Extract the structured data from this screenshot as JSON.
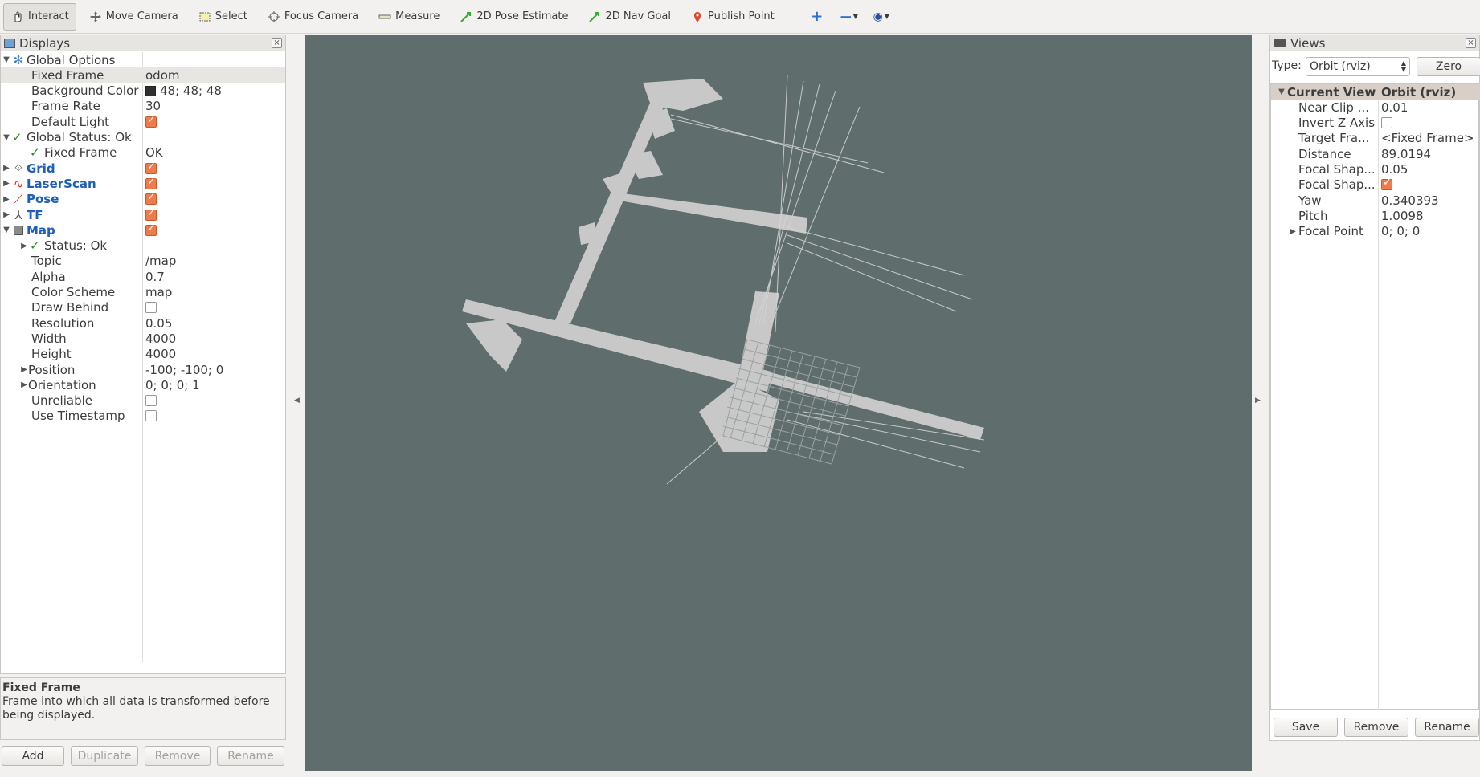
{
  "toolbar": {
    "tools": [
      {
        "label": "Interact",
        "icon": "hand-icon",
        "active": true
      },
      {
        "label": "Move Camera",
        "icon": "move-camera-icon"
      },
      {
        "label": "Select",
        "icon": "select-icon"
      },
      {
        "label": "Focus Camera",
        "icon": "focus-camera-icon"
      },
      {
        "label": "Measure",
        "icon": "ruler-icon"
      },
      {
        "label": "2D Pose Estimate",
        "icon": "green-arrow-icon"
      },
      {
        "label": "2D Nav Goal",
        "icon": "green-arrow-icon"
      },
      {
        "label": "Publish Point",
        "icon": "map-pin-icon"
      }
    ]
  },
  "displays": {
    "title": "Displays",
    "rows": [
      {
        "name": "Global Options",
        "value": ""
      },
      {
        "name": "Fixed Frame",
        "value": "odom"
      },
      {
        "name": "Background Color",
        "value": "48; 48; 48"
      },
      {
        "name": "Frame Rate",
        "value": "30"
      },
      {
        "name": "Default Light",
        "value": ""
      },
      {
        "name": "Global Status: Ok",
        "value": ""
      },
      {
        "name": "Fixed Frame",
        "value": "OK"
      },
      {
        "name": "Grid",
        "value": ""
      },
      {
        "name": "LaserScan",
        "value": ""
      },
      {
        "name": "Pose",
        "value": ""
      },
      {
        "name": "TF",
        "value": ""
      },
      {
        "name": "Map",
        "value": ""
      },
      {
        "name": "Status: Ok",
        "value": ""
      },
      {
        "name": "Topic",
        "value": "/map"
      },
      {
        "name": "Alpha",
        "value": "0.7"
      },
      {
        "name": "Color Scheme",
        "value": "map"
      },
      {
        "name": "Draw Behind",
        "value": ""
      },
      {
        "name": "Resolution",
        "value": "0.05"
      },
      {
        "name": "Width",
        "value": "4000"
      },
      {
        "name": "Height",
        "value": "4000"
      },
      {
        "name": "Position",
        "value": "-100; -100; 0"
      },
      {
        "name": "Orientation",
        "value": "0; 0; 0; 1"
      },
      {
        "name": "Unreliable",
        "value": ""
      },
      {
        "name": "Use Timestamp",
        "value": ""
      }
    ],
    "description_title": "Fixed Frame",
    "description_text": "Frame into which all data is transformed before being displayed.",
    "buttons": {
      "add": "Add",
      "duplicate": "Duplicate",
      "remove": "Remove",
      "rename": "Rename"
    }
  },
  "views": {
    "title": "Views",
    "type_label": "Type:",
    "type_value": "Orbit (rviz)",
    "zero_label": "Zero",
    "rows": [
      {
        "name": "Current View",
        "value": "Orbit (rviz)"
      },
      {
        "name": "Near Clip ...",
        "value": "0.01"
      },
      {
        "name": "Invert Z Axis",
        "value": ""
      },
      {
        "name": "Target Fra...",
        "value": "<Fixed Frame>"
      },
      {
        "name": "Distance",
        "value": "89.0194"
      },
      {
        "name": "Focal Shap...",
        "value": "0.05"
      },
      {
        "name": "Focal Shap...",
        "value": ""
      },
      {
        "name": "Yaw",
        "value": "0.340393"
      },
      {
        "name": "Pitch",
        "value": "1.0098"
      },
      {
        "name": "Focal Point",
        "value": "0; 0; 0"
      }
    ],
    "buttons": {
      "save": "Save",
      "remove": "Remove",
      "rename": "Rename"
    }
  },
  "colors": {
    "viewport_bg": "#5f6d6d",
    "map_free": "#c8c8c8",
    "accent_checkbox": "#ef7a4a",
    "tree_blue": "#1f5fb8"
  }
}
